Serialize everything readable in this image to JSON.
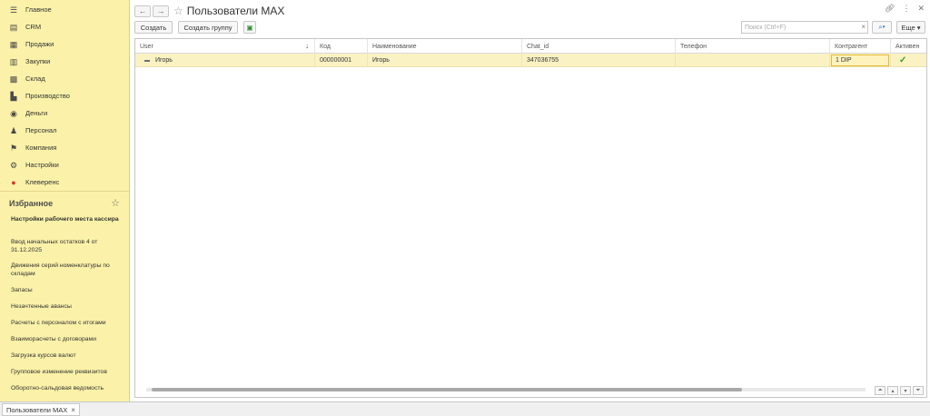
{
  "sidebar": {
    "nav": [
      {
        "label": "Главное",
        "icon": "menu-icon"
      },
      {
        "label": "CRM",
        "icon": "crm-icon"
      },
      {
        "label": "Продажи",
        "icon": "sales-icon"
      },
      {
        "label": "Закупки",
        "icon": "purchases-icon"
      },
      {
        "label": "Склад",
        "icon": "warehouse-icon"
      },
      {
        "label": "Производство",
        "icon": "factory-icon"
      },
      {
        "label": "Деньги",
        "icon": "money-icon"
      },
      {
        "label": "Персонал",
        "icon": "people-icon"
      },
      {
        "label": "Компания",
        "icon": "flag-icon"
      },
      {
        "label": "Настройки",
        "icon": "gear-icon"
      },
      {
        "label": "Клеверенс",
        "icon": "cleverence-icon"
      }
    ],
    "favorites_title": "Избранное",
    "favorites": [
      "Настройки рабочего места кассира",
      "Ввод начальных остатков 4 от 31.12.2025",
      "Движения серий номенклатуры по складам",
      "Запасы",
      "Незачтенные авансы",
      "Расчеты с персоналом с итогами",
      "Взаиморасчеты с договорами",
      "Загрузка курсов валют",
      "Групповое изменение реквизитов",
      "Оборотно-сальдовая ведомость"
    ]
  },
  "main": {
    "title": "Пользователи MAX",
    "toolbar": {
      "create": "Создать",
      "create_group": "Создать группу",
      "search_placeholder": "Поиск (Ctrl+F)",
      "more": "Еще"
    },
    "table": {
      "columns": [
        "User",
        "Код",
        "Наименование",
        "Chat_id",
        "Телефон",
        "Контрагент",
        "Активен"
      ],
      "rows": [
        {
          "user": "Игорь",
          "code": "000000001",
          "name": "Игорь",
          "chat_id": "347036755",
          "phone": "",
          "counterparty": "1 DIP",
          "active": true
        }
      ]
    }
  },
  "tabbar": {
    "tab_label": "Пользователи MAX"
  },
  "colors": {
    "sidebar_bg": "#fbf1a8",
    "row_selected": "#fbf2c4",
    "check_green": "#3a9a2b"
  }
}
